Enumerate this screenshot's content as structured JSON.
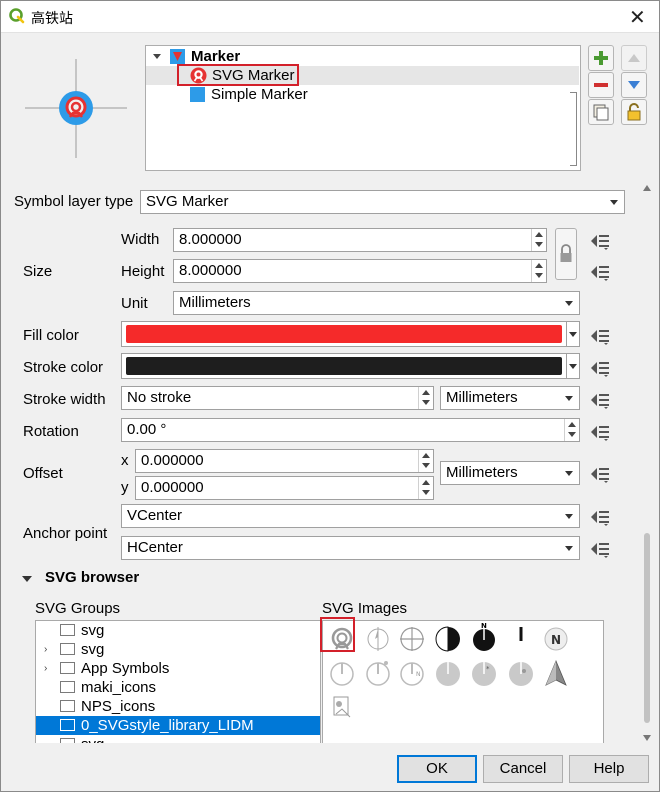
{
  "window": {
    "title": "高铁站",
    "close_glyph": "✕"
  },
  "layers_tree": {
    "root_label": "Marker",
    "items": [
      {
        "label": "SVG Marker",
        "selected": true
      },
      {
        "label": "Simple Marker",
        "selected": false
      }
    ]
  },
  "side_buttons": {
    "add": "add-layer-icon",
    "remove": "remove-layer-icon",
    "duplicate": "duplicate-layer-icon",
    "lock": "lock-icon",
    "up": "move-up-icon",
    "down": "move-down-icon"
  },
  "form": {
    "symbol_layer_type_label": "Symbol layer type",
    "symbol_layer_type_value": "SVG Marker",
    "size_label": "Size",
    "width_label": "Width",
    "width_value": "8.000000",
    "height_label": "Height",
    "height_value": "8.000000",
    "unit_label": "Unit",
    "unit_value": "Millimeters",
    "fill_color_label": "Fill color",
    "fill_color": "#f52a2a",
    "stroke_color_label": "Stroke color",
    "stroke_color": "#1e1e1e",
    "stroke_width_label": "Stroke width",
    "stroke_width_value": "No stroke",
    "stroke_width_unit": "Millimeters",
    "rotation_label": "Rotation",
    "rotation_value": "0.00 °",
    "offset_label": "Offset",
    "offset_x_label": "x",
    "offset_x_value": "0.000000",
    "offset_y_label": "y",
    "offset_y_value": "0.000000",
    "offset_unit": "Millimeters",
    "anchor_label": "Anchor point",
    "anchor_v_value": "VCenter",
    "anchor_h_value": "HCenter"
  },
  "svg_browser": {
    "section_label": "SVG browser",
    "groups_label": "SVG Groups",
    "images_label": "SVG Images",
    "groups": [
      {
        "label": "svg",
        "expandable": false,
        "selected": false
      },
      {
        "label": "svg",
        "expandable": true,
        "selected": false
      },
      {
        "label": "App Symbols",
        "expandable": true,
        "selected": false
      },
      {
        "label": "maki_icons",
        "expandable": false,
        "selected": false
      },
      {
        "label": "NPS_icons",
        "expandable": false,
        "selected": false
      },
      {
        "label": "0_SVGstyle_library_LIDM",
        "expandable": false,
        "selected": true
      },
      {
        "label": "svg",
        "expandable": false,
        "selected": false
      }
    ],
    "images": [
      "railway-station-icon",
      "north-arrow-circle-icon",
      "crosshair-circle-icon",
      "north-arrow-black-half-icon",
      "north-arrow-black-n-icon",
      "north-line-icon",
      "north-n-badge-icon",
      "north-arrow-gray-icon",
      "north-arrow-gray-dot-icon",
      "north-arrow-gray-n-icon",
      "north-arrow-gray-half-icon",
      "north-arrow-gray-star-icon",
      "north-arrow-gray-dot2-icon",
      "north-arrow-3d-icon",
      "svg-image-placeholder-icon"
    ]
  },
  "footer": {
    "ok": "OK",
    "cancel": "Cancel",
    "help": "Help"
  },
  "colors": {
    "accent": "#0078d7",
    "highlight_frame": "#d3202a",
    "marker_blue": "#2d9be8"
  }
}
